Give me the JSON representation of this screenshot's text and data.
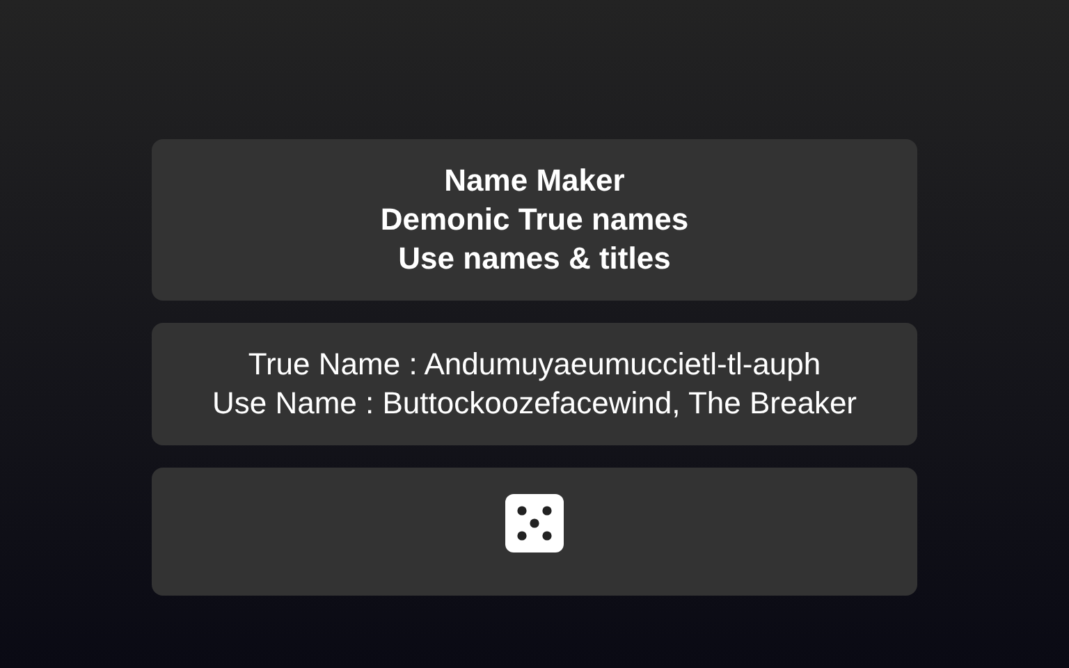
{
  "header": {
    "lines": [
      "Name Maker",
      "Demonic True names",
      "Use names & titles"
    ]
  },
  "results": [
    "True Name : Andumuyaeumuccietl-tl-auph",
    "Use Name : Buttockoozefacewind, The Breaker"
  ]
}
